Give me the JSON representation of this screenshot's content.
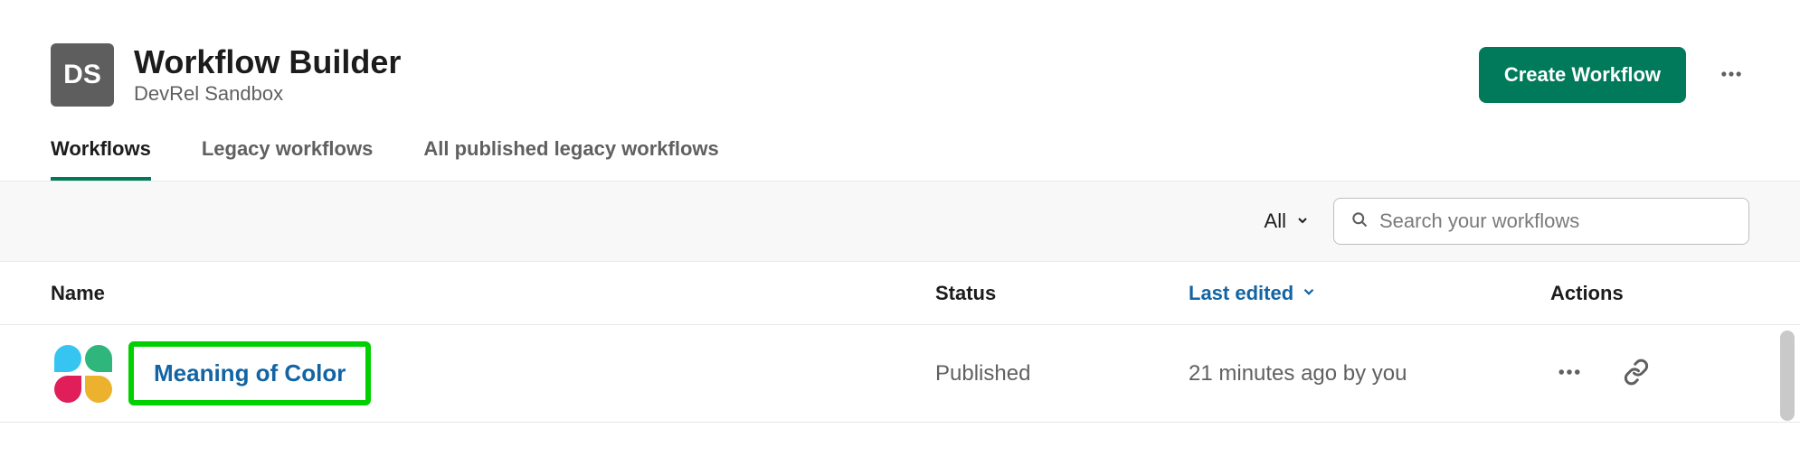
{
  "header": {
    "workspace_initials": "DS",
    "title": "Workflow Builder",
    "workspace_name": "DevRel Sandbox",
    "create_button": "Create Workflow"
  },
  "tabs": [
    {
      "label": "Workflows",
      "active": true
    },
    {
      "label": "Legacy workflows",
      "active": false
    },
    {
      "label": "All published legacy workflows",
      "active": false
    }
  ],
  "toolbar": {
    "filter_label": "All",
    "search_placeholder": "Search your workflows"
  },
  "table": {
    "columns": {
      "name": "Name",
      "status": "Status",
      "last_edited": "Last edited",
      "actions": "Actions"
    },
    "rows": [
      {
        "name": "Meaning of Color",
        "status": "Published",
        "last_edited": "21 minutes ago by you"
      }
    ]
  }
}
